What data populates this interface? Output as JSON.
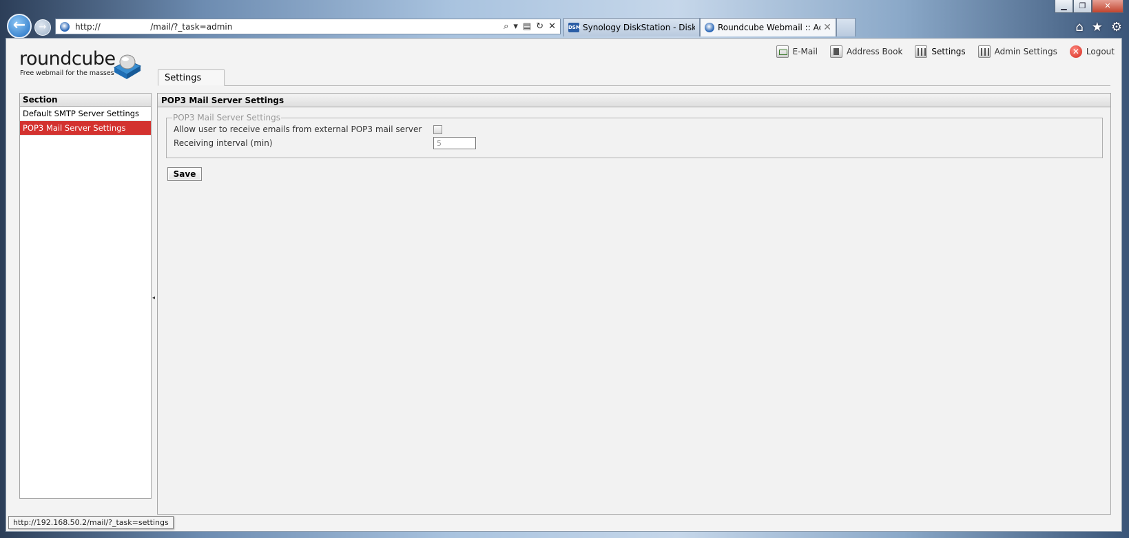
{
  "browser": {
    "address_text": "http://                   /mail/?_task=admin",
    "tabs": [
      {
        "icon": "synology-dsm-icon",
        "label": "Synology DiskStation - DiskSta..."
      },
      {
        "icon": "roundcube-icon",
        "label": "Roundcube Webmail :: Ad..."
      }
    ],
    "status_url": "http://192.168.50.2/mail/?_task=settings"
  },
  "app": {
    "logo_word": "roundcube",
    "logo_tagline": "Free webmail for the masses",
    "nav": {
      "email": "E-Mail",
      "address_book": "Address Book",
      "settings": "Settings",
      "admin_settings": "Admin Settings",
      "logout": "Logout"
    },
    "tab_label": "Settings"
  },
  "sidebar": {
    "header": "Section",
    "items": [
      {
        "label": "Default SMTP Server Settings",
        "selected": false
      },
      {
        "label": "POP3 Mail Server Settings",
        "selected": true
      }
    ]
  },
  "main": {
    "header": "POP3 Mail Server Settings",
    "fieldset_legend": "POP3 Mail Server Settings",
    "allow_label": "Allow user to receive emails from external POP3 mail server",
    "allow_checked": false,
    "interval_label": "Receiving interval (min)",
    "interval_value": "5",
    "save_label": "Save"
  },
  "colors": {
    "selected_row": "#d3322f",
    "panel_bg": "#f3f3f3"
  }
}
